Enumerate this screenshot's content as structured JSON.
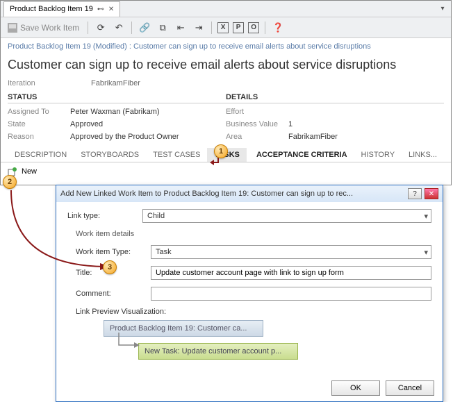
{
  "tab": {
    "title": "Product Backlog Item 19"
  },
  "toolbar": {
    "save": "Save Work Item"
  },
  "breadcrumb": "Product Backlog Item 19 (Modified) : Customer can sign up to receive email alerts about service disruptions",
  "title": "Customer can sign up to receive email alerts about service disruptions",
  "iteration": {
    "label": "Iteration",
    "value": "FabrikamFiber"
  },
  "status": {
    "header": "STATUS",
    "assigned_label": "Assigned To",
    "assigned": "Peter Waxman (Fabrikam)",
    "state_label": "State",
    "state": "Approved",
    "reason_label": "Reason",
    "reason": "Approved by the Product Owner"
  },
  "details": {
    "header": "DETAILS",
    "effort_label": "Effort",
    "effort": "",
    "bv_label": "Business Value",
    "bv": "1",
    "area_label": "Area",
    "area": "FabrikamFiber"
  },
  "tabs": {
    "description": "DESCRIPTION",
    "storyboards": "STORYBOARDS",
    "testcases": "TEST CASES",
    "tasks": "TASKS",
    "acceptance": "ACCEPTANCE CRITERIA",
    "history": "HISTORY",
    "links": "LINKS..."
  },
  "newbtn": "New",
  "callouts": {
    "c1": "1",
    "c2": "2",
    "c3": "3"
  },
  "dialog": {
    "title": "Add New Linked Work Item to Product Backlog Item 19: Customer can sign up to rec...",
    "linktype_label": "Link type:",
    "linktype": "Child",
    "section": "Work item details",
    "witype_label": "Work item Type:",
    "witype": "Task",
    "title_label": "Title:",
    "title_val": "Update customer account page with link to sign up form",
    "comment_label": "Comment:",
    "comment": "",
    "preview_label": "Link Preview Visualization:",
    "pv_parent": "Product Backlog Item 19: Customer ca...",
    "pv_child": "New Task: Update customer account p...",
    "ok": "OK",
    "cancel": "Cancel"
  }
}
